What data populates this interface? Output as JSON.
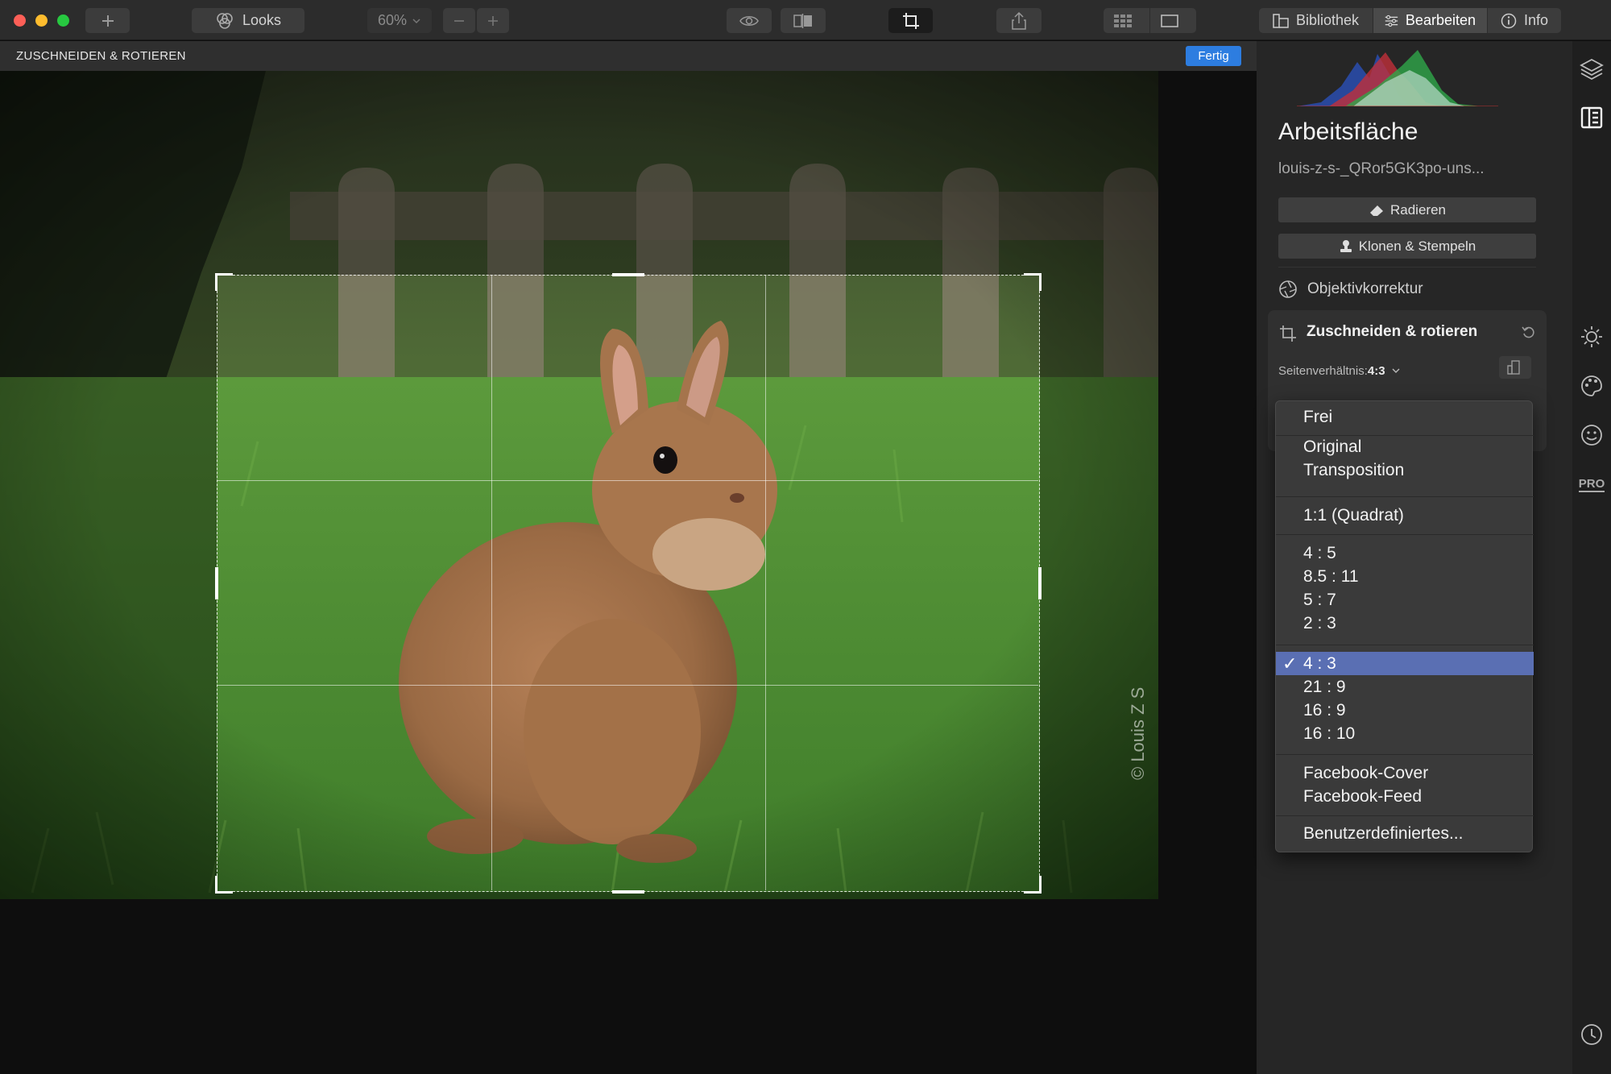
{
  "toolbar": {
    "looks_label": "Looks",
    "zoom_value": "60%",
    "library_label": "Bibliothek",
    "edit_label": "Bearbeiten",
    "info_label": "Info"
  },
  "crop_header": {
    "title": "ZUSCHNEIDEN & ROTIEREN",
    "done_label": "Fertig"
  },
  "canvas": {
    "watermark": "© Louis Z S"
  },
  "panel": {
    "title": "Arbeitsfläche",
    "file_name": "louis-z-s-_QRor5GK3po-uns...",
    "erase_label": "Radieren",
    "clone_label": "Klonen & Stempeln",
    "lens_label": "Objektivkorrektur",
    "crop_section_title": "Zuschneiden & rotieren",
    "aspect_label": "Seitenverhältnis:",
    "aspect_value": "4:3"
  },
  "sidebar_icons": [
    "layers-icon",
    "canvas-icon",
    "sun-icon",
    "palette-icon",
    "face-icon",
    "pro-icon",
    "history-icon"
  ],
  "sidebar_pro_label": "PRO",
  "aspect_menu": {
    "groups": [
      [
        "Frei"
      ],
      [
        "Original",
        "Transposition"
      ],
      [
        "1:1 (Quadrat)"
      ],
      [
        "4 : 5",
        "8.5 : 11",
        "5 : 7",
        "2 : 3"
      ],
      [
        "4 : 3",
        "21 : 9",
        "16 : 9",
        "16 : 10"
      ],
      [
        "Facebook-Cover",
        "Facebook-Feed"
      ],
      [
        "Benutzerdefiniertes..."
      ]
    ],
    "selected": "4 : 3",
    "selected_color": "#5a6fb3"
  },
  "colors": {
    "accent": "#2d7de0",
    "toolbar_bg": "#2c2c2c",
    "panel_bg": "#262626"
  }
}
